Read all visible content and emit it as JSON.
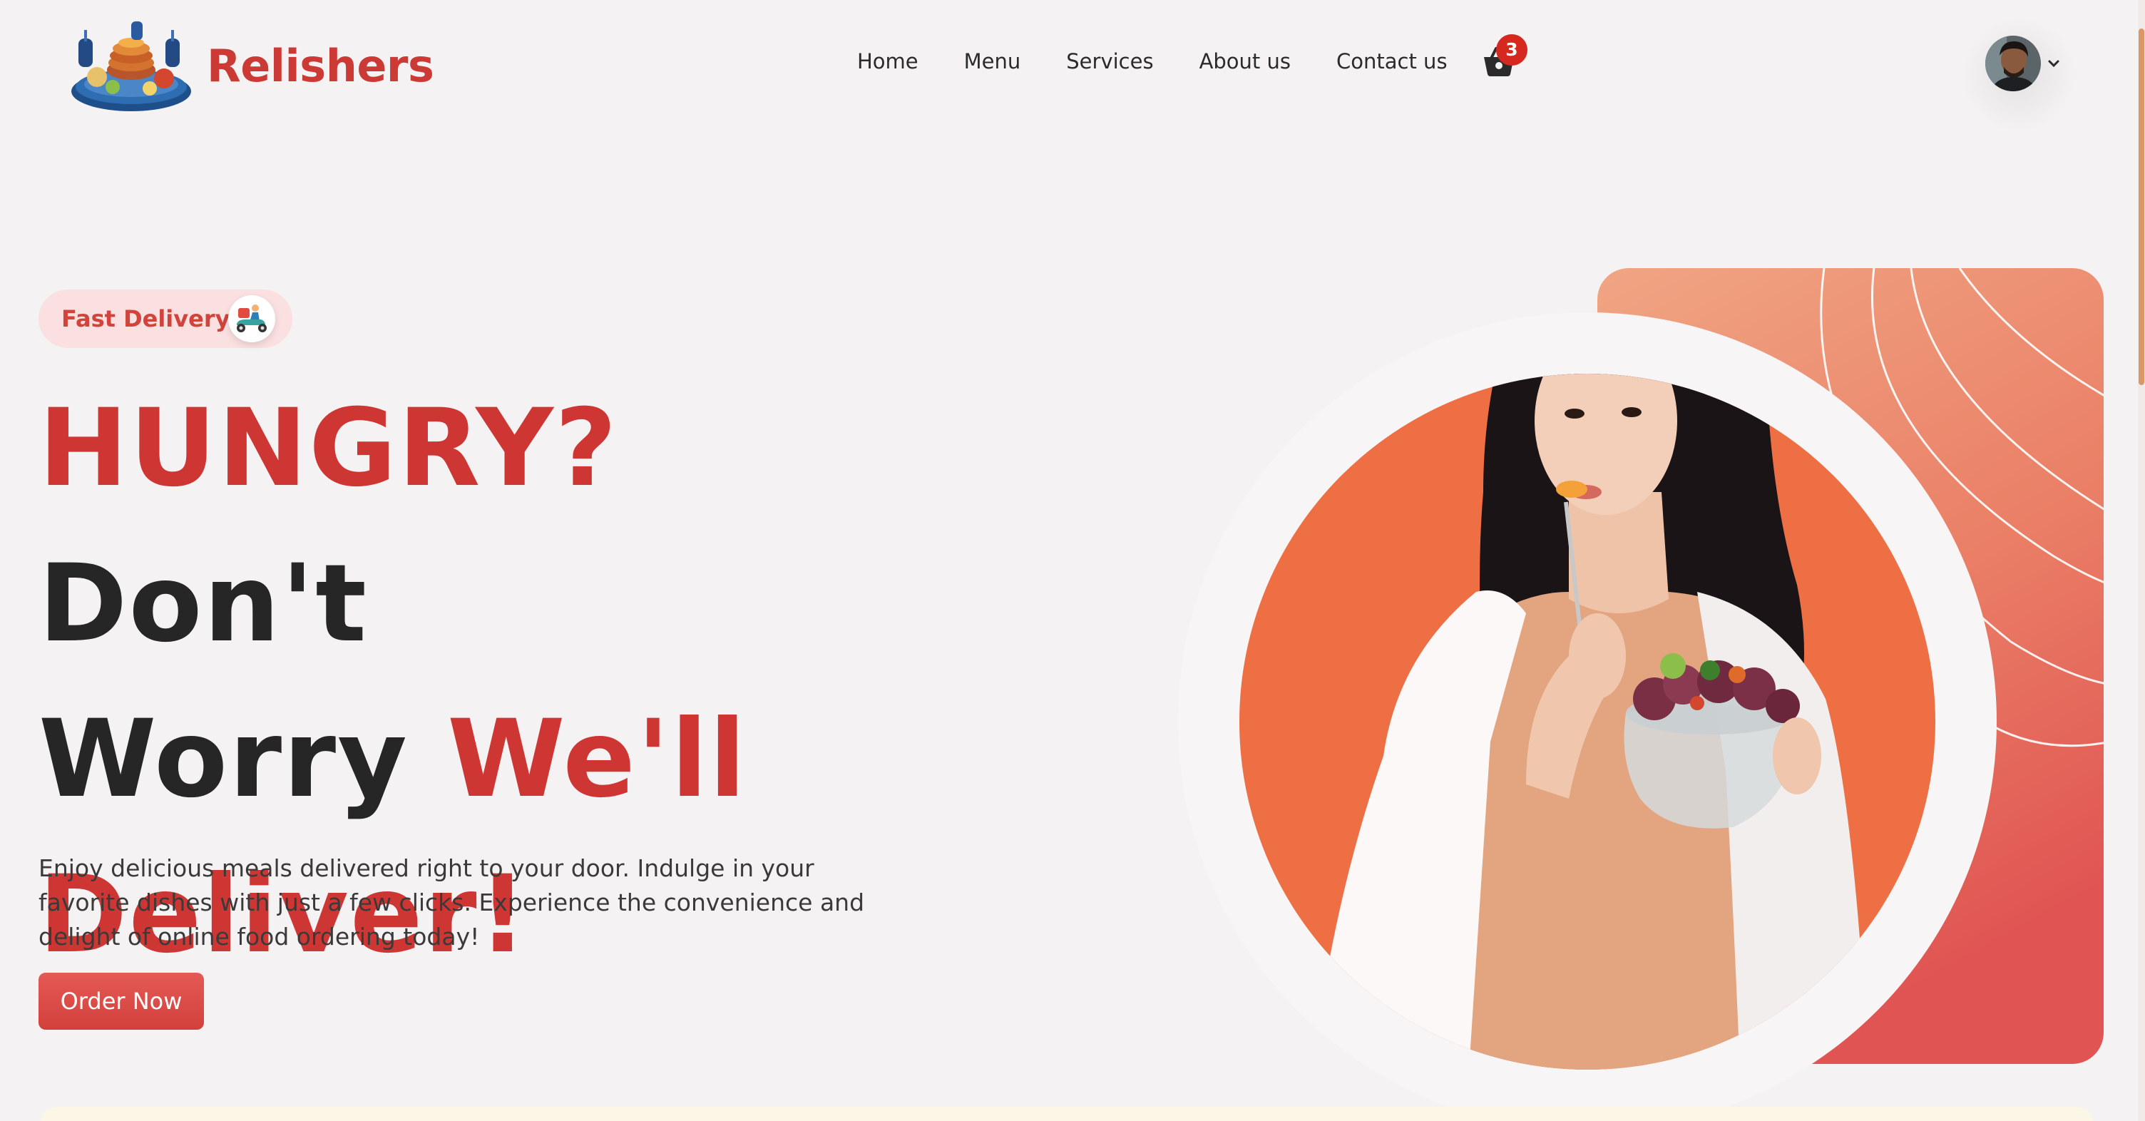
{
  "header": {
    "brand_name": "Relishers",
    "logo_icon": "food-platter-logo",
    "nav_items": [
      "Home",
      "Menu",
      "Services",
      "About us",
      "Contact us"
    ],
    "cart_icon": "shopping-basket-icon",
    "cart_count": "3",
    "profile_icon": "user-avatar",
    "dropdown_icon": "chevron-down-icon"
  },
  "hero": {
    "badge_label": "Fast Delivery",
    "badge_icon": "delivery-scooter-icon",
    "headline": {
      "part1": "HUNGRY?",
      "part2": "Don't",
      "part3": "Worry",
      "part4": "We'll",
      "part5": "Deliver!"
    },
    "description": "Enjoy delicious meals delivered right to your door. Indulge in your favorite dishes with just a few clicks. Experience the convenience and delight of online food ordering today!",
    "cta_label": "Order Now",
    "image_subject": "woman-eating-salad-photo"
  },
  "colors": {
    "brand_red": "#ce3634",
    "page_bg": "#f5f2f3",
    "accent_orange": "#ef6f45",
    "badge_bg": "#fbe0e1",
    "cart_badge": "#d5281f"
  }
}
